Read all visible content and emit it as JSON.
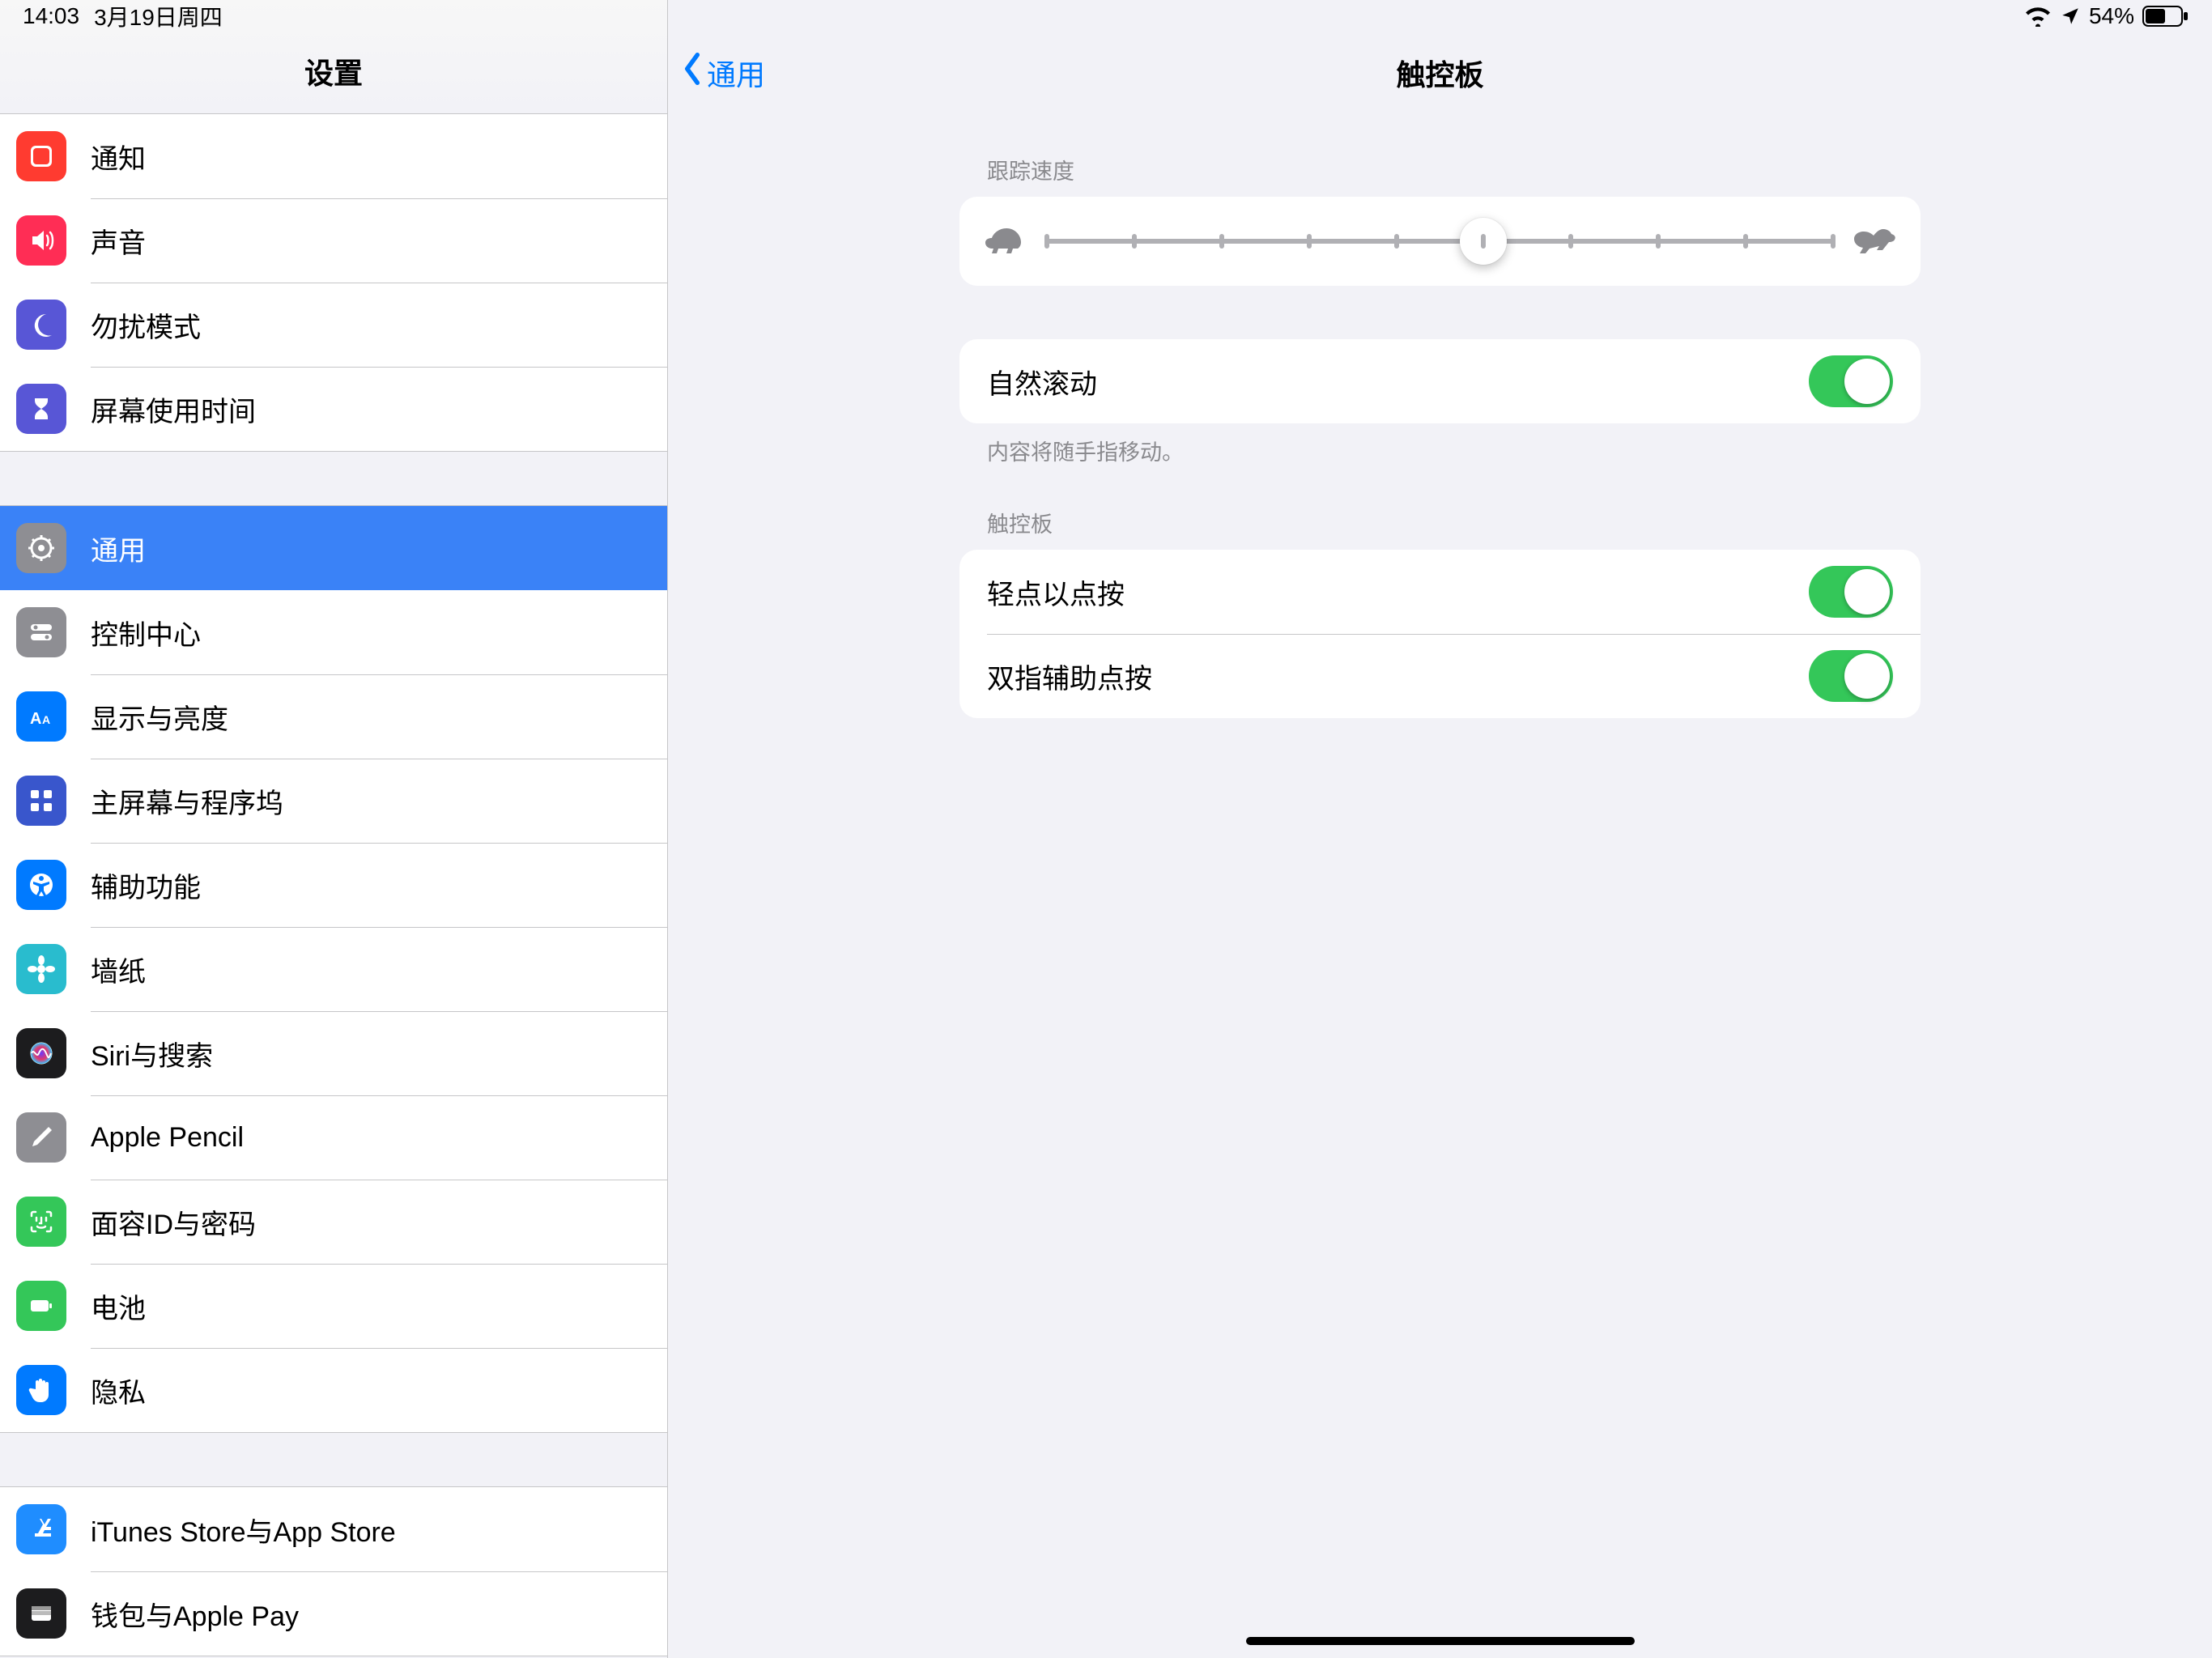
{
  "status": {
    "time": "14:03",
    "date": "3月19日周四",
    "battery_pct": "54%"
  },
  "sidebar": {
    "title": "设置",
    "groups": [
      {
        "items": [
          {
            "id": "notifications",
            "label": "通知",
            "icon": "bell-square-icon",
            "color": "#ff3b30"
          },
          {
            "id": "sounds",
            "label": "声音",
            "icon": "speaker-icon",
            "color": "#ff2d55"
          },
          {
            "id": "dnd",
            "label": "勿扰模式",
            "icon": "moon-icon",
            "color": "#5856d6"
          },
          {
            "id": "screentime",
            "label": "屏幕使用时间",
            "icon": "hourglass-icon",
            "color": "#5856d6"
          }
        ]
      },
      {
        "items": [
          {
            "id": "general",
            "label": "通用",
            "icon": "gear-icon",
            "color": "#8e8e93",
            "selected": true
          },
          {
            "id": "controlcenter",
            "label": "控制中心",
            "icon": "switches-icon",
            "color": "#8e8e93"
          },
          {
            "id": "display",
            "label": "显示与亮度",
            "icon": "text-size-icon",
            "color": "#007aff"
          },
          {
            "id": "homescreen",
            "label": "主屏幕与程序坞",
            "icon": "grid-icon",
            "color": "#3956cc"
          },
          {
            "id": "accessibility",
            "label": "辅助功能",
            "icon": "accessibility-icon",
            "color": "#007aff"
          },
          {
            "id": "wallpaper",
            "label": "墙纸",
            "icon": "flower-icon",
            "color": "#29bcce"
          },
          {
            "id": "siri",
            "label": "Siri与搜索",
            "icon": "siri-icon",
            "color": "#1c1c1e"
          },
          {
            "id": "pencil",
            "label": "Apple Pencil",
            "icon": "pencil-icon",
            "color": "#8e8e93"
          },
          {
            "id": "faceid",
            "label": "面容ID与密码",
            "icon": "faceid-icon",
            "color": "#34c759"
          },
          {
            "id": "battery",
            "label": "电池",
            "icon": "battery-icon",
            "color": "#34c759"
          },
          {
            "id": "privacy",
            "label": "隐私",
            "icon": "hand-icon",
            "color": "#007aff"
          }
        ]
      },
      {
        "items": [
          {
            "id": "itunes",
            "label": "iTunes Store与App Store",
            "icon": "appstore-icon",
            "color": "#1f8dff"
          },
          {
            "id": "wallet",
            "label": "钱包与Apple Pay",
            "icon": "wallet-icon",
            "color": "#1c1c1e"
          }
        ]
      }
    ]
  },
  "detail": {
    "back_label": "通用",
    "title": "触控板",
    "tracking": {
      "header": "跟踪速度",
      "ticks": 10,
      "value_index": 5
    },
    "natural_scroll": {
      "label": "自然滚动",
      "on": true,
      "footer": "内容将随手指移动。"
    },
    "trackpad_section": {
      "header": "触控板",
      "rows": [
        {
          "id": "tap-to-click",
          "label": "轻点以点按",
          "on": true
        },
        {
          "id": "two-finger-sec",
          "label": "双指辅助点按",
          "on": true
        }
      ]
    }
  }
}
